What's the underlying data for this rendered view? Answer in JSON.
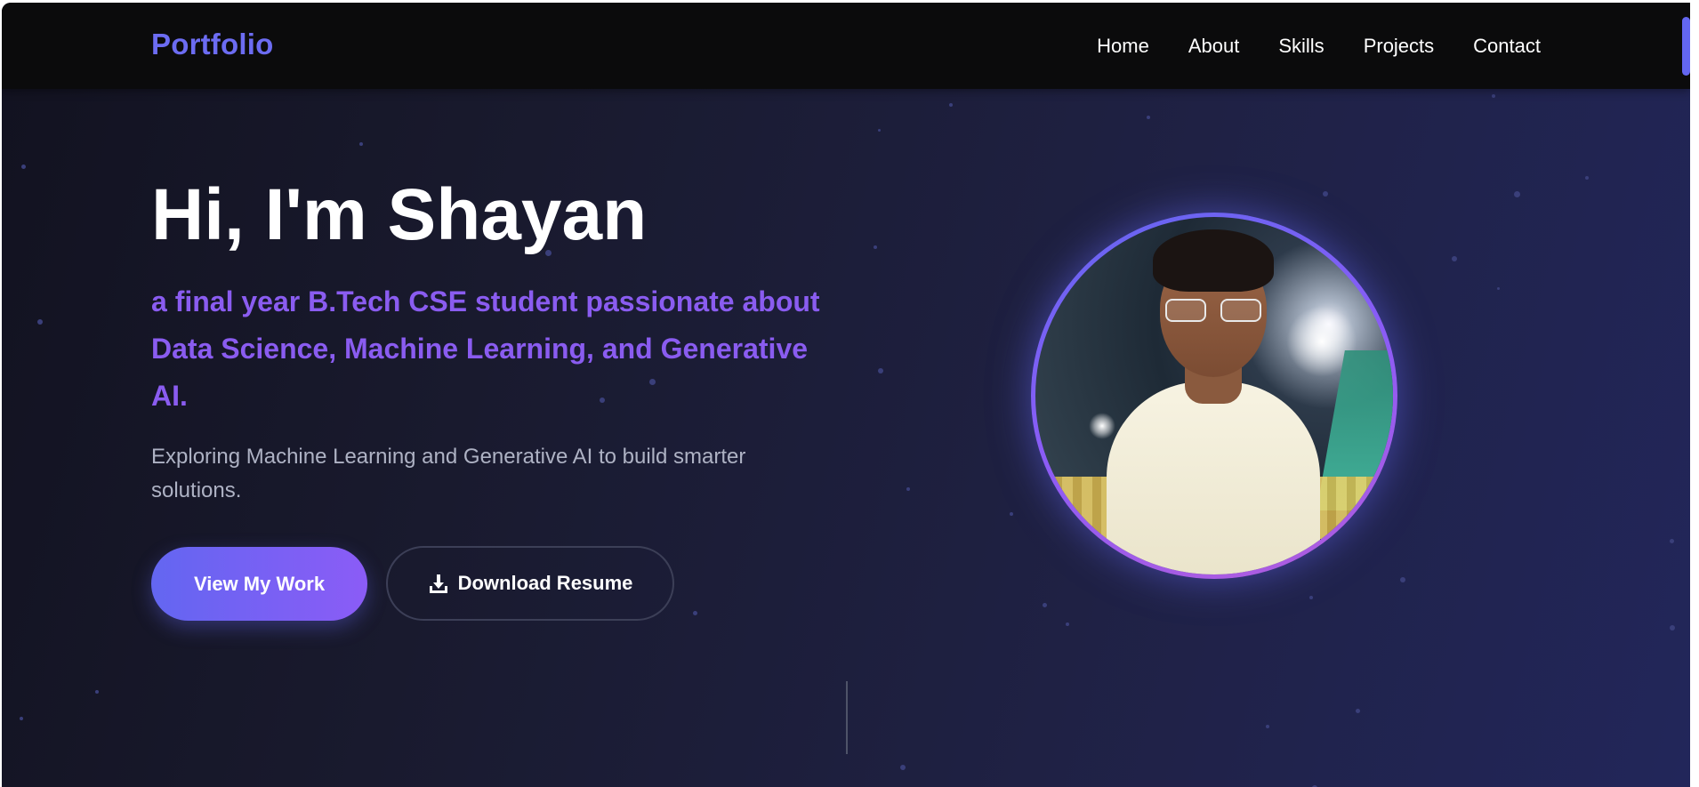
{
  "navbar": {
    "logo": "Portfolio",
    "links": [
      "Home",
      "About",
      "Skills",
      "Projects",
      "Contact"
    ]
  },
  "hero": {
    "title": "Hi, I'm Shayan",
    "subtitle": "a final year B.Tech CSE student passionate about Data Science, Machine Learning, and Generative AI.",
    "description": "Exploring Machine Learning and Generative AI to build smarter solutions.",
    "primary_button": "View My Work",
    "secondary_button": "Download Resume",
    "secondary_icon": "download-icon"
  },
  "colors": {
    "accent": "#6366f1",
    "accent_secondary": "#8b5cf6",
    "subtitle": "#8a5cf0",
    "background_dark": "#121220",
    "navbar_background": "#0b0b0c"
  }
}
